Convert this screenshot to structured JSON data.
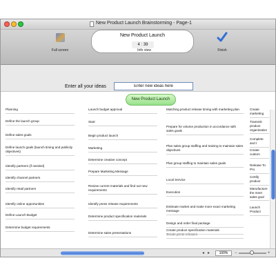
{
  "window": {
    "title": "New Product Launch Brainstorming - Page-1"
  },
  "toolbar": {
    "fullscreen_label": "Full screen",
    "info_title": "New Product Launch",
    "timer": "4 : 39",
    "info_label": "Info view",
    "finish_label": "Finish"
  },
  "entry": {
    "prompt": "Enter all your ideas",
    "input_value": "Enter new ideas here"
  },
  "product_launch_button": "New Product Launch",
  "columns": [
    {
      "items": [
        "Planning",
        "Define the launch group",
        "Define sales goals",
        "Define launch goals (launch timing and publicity objectives)",
        "Identify partners (if needed)",
        "Identify channel partners",
        "Identify retail partners",
        "Identify online opportunities",
        "Define Launch Budget",
        "Determine budget requirements"
      ]
    },
    {
      "items": [
        "Launch budget approval",
        "Start",
        "Begin product launch",
        "Marketing",
        "Determine creative concept",
        "Prepare Marketing Message",
        "Review current materials and find out new requirements",
        "Identify press release requirements",
        "Determine product specification materials",
        "Determine sales presentations"
      ]
    },
    {
      "items": [
        "Matching product release timing with marketing plan",
        "Prepare for volume production in accordance with sales goals",
        "Plan sales group staffing and training to maintain sales objectives",
        "Plan group staffing to maintain sales goals",
        "Local Service",
        "Execution",
        "Estimate market and make more exact marketing message",
        "Design and order final package",
        "Create press releases",
        "Create product specification materials"
      ]
    },
    {
      "items": [
        "Create marketing",
        "Transmit product organization",
        "Complete and t",
        "Create custom",
        "Release To Pro",
        "Certify product",
        "Manufacture the meet sales goal",
        "Launch Product"
      ]
    }
  ],
  "status": {
    "zoom": "100%"
  }
}
